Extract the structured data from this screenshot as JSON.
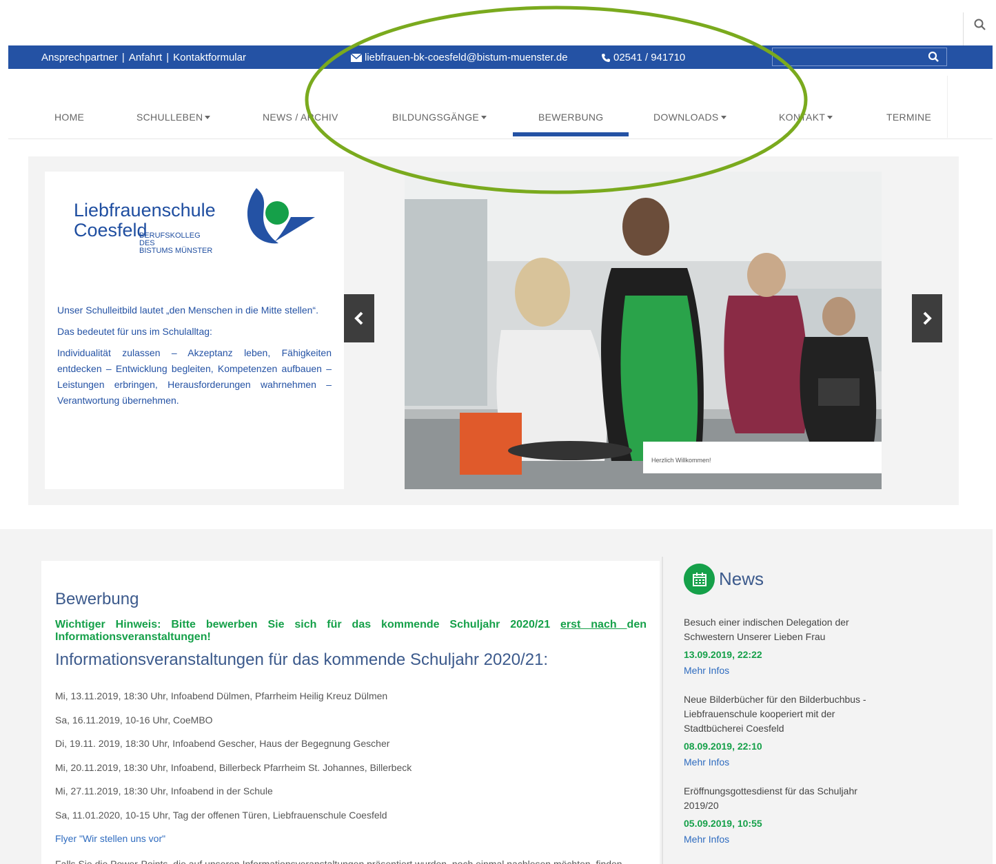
{
  "topbar": {
    "links": [
      "Ansprechpartner",
      "Anfahrt",
      "Kontaktformular"
    ],
    "separator": "|",
    "email": "liebfrauen-bk-coesfeld@bistum-muenster.de",
    "phone": "02541 / 941710",
    "search_placeholder": ""
  },
  "nav": {
    "items": [
      {
        "label": "HOME",
        "dropdown": false
      },
      {
        "label": "SCHULLEBEN",
        "dropdown": true
      },
      {
        "label": "NEWS / ARCHIV",
        "dropdown": false
      },
      {
        "label": "BILDUNGSGÄNGE",
        "dropdown": true
      },
      {
        "label": "BEWERBUNG",
        "dropdown": false,
        "active": true
      },
      {
        "label": "DOWNLOADS",
        "dropdown": true
      },
      {
        "label": "KONTAKT",
        "dropdown": true
      },
      {
        "label": "TERMINE",
        "dropdown": false
      }
    ]
  },
  "hero": {
    "logo": {
      "line1": "Liebfrauenschule",
      "line2": "Coesfeld",
      "sub1": "BERUFSKOLLEG",
      "sub2": "DES",
      "sub3": "BISTUMS MÜNSTER"
    },
    "intro": [
      "Unser Schulleitbild lautet „den Menschen in die Mitte stellen“.",
      "Das bedeutet für uns im Schulalltag:",
      "Individualität zulassen – Akzeptanz leben, Fähigkeiten entdecken – Entwicklung begleiten, Kompetenzen aufbauen – Leistungen erbringen, Herausforderungen wahrnehmen – Verantwortung übernehmen."
    ],
    "caption": "Herzlich Willkommen!"
  },
  "main": {
    "heading": "Bewerbung",
    "notice_pre": "Wichtiger Hinweis: Bitte bewerben Sie sich für das kommende Schuljahr 2020/21 ",
    "notice_ul": "erst nach ",
    "notice_post": "den Informationsveranstaltungen!",
    "subheading": "Informationsveranstaltungen für das kommende Schuljahr 2020/21:",
    "events": [
      "Mi, 13.11.2019, 18:30 Uhr, Infoabend Dülmen, Pfarrheim Heilig Kreuz Dülmen",
      "Sa, 16.11.2019,  10-16 Uhr, CoeMBO",
      "Di, 19.11. 2019, 18:30 Uhr, Infoabend Gescher, Haus der Begegnung Gescher",
      "Mi, 20.11.2019, 18:30 Uhr, Infoabend, Billerbeck Pfarrheim St. Johannes, Billerbeck",
      "Mi, 27.11.2019, 18:30 Uhr, Infoabend in der Schule",
      "Sa, 11.01.2020, 10-15 Uhr, Tag der offenen Türen, Liebfrauenschule Coesfeld"
    ],
    "flyer_link": "Flyer \"Wir stellen uns vor\"",
    "more_text": "Falls Sie die Power-Points, die auf unseren Informationsveranstaltungen präsentiert wurden, noch einmal nachlesen möchten, finden"
  },
  "news": {
    "title": "News",
    "items": [
      {
        "text": "Besuch einer indischen Delegation der Schwestern Unserer Lieben Frau",
        "date": "13.09.2019, 22:22",
        "link": "Mehr Infos"
      },
      {
        "text": "Neue Bilderbücher für den Bilderbuchbus - Liebfrauenschule kooperiert mit der Stadtbücherei Coesfeld",
        "date": "08.09.2019, 22:10",
        "link": "Mehr Infos"
      },
      {
        "text": "Eröffnungsgottesdienst für das Schuljahr 2019/20",
        "date": "05.09.2019, 10:55",
        "link": "Mehr Infos"
      }
    ]
  },
  "colors": {
    "primary_blue": "#2452a4",
    "green": "#15a049",
    "annotation": "#7aaa1e"
  }
}
